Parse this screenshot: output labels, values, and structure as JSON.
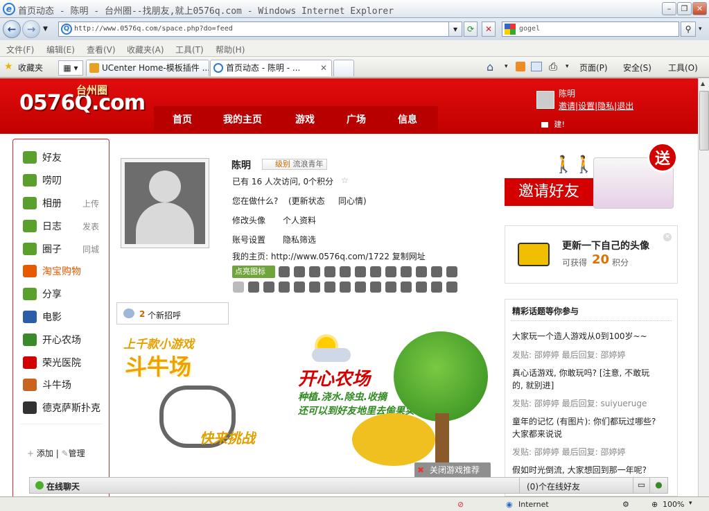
{
  "window": {
    "title": "首页动态 - 陈明 - 台州圈--找朋友,就上0576q.com - Windows Internet Explorer"
  },
  "address": {
    "url": "http://www.0576q.com/space.php?do=feed",
    "search_value": "gogel"
  },
  "menu": [
    "文件(F)",
    "编辑(E)",
    "查看(V)",
    "收藏夹(A)",
    "工具(T)",
    "帮助(H)"
  ],
  "favorites_label": "收藏夹",
  "tabs": [
    {
      "label": "UCenter Home-模板插件 ..."
    },
    {
      "label": "首页动态 - 陈明 - ..."
    }
  ],
  "toolbar": {
    "page": "页面(P)",
    "safety": "安全(S)",
    "tools": "工具(O)"
  },
  "site": {
    "logo": "0576Q.com",
    "logo_tag": "台州圈",
    "nav": [
      "首页",
      "我的主页",
      "游戏",
      "广场",
      "信息"
    ],
    "user": {
      "name": "陈明",
      "links": [
        "邀请",
        "设置",
        "隐私",
        "退出"
      ],
      "notice": "建!"
    }
  },
  "sidebar": {
    "items": [
      {
        "label": "好友",
        "extra": "",
        "icon": "friends-icon",
        "color": "#5aa02c"
      },
      {
        "label": "唠叨",
        "extra": "",
        "icon": "chat-icon",
        "color": "#5aa02c"
      },
      {
        "label": "相册",
        "extra": "上传",
        "icon": "camera-icon",
        "color": "#5aa02c"
      },
      {
        "label": "日志",
        "extra": "发表",
        "icon": "log-icon",
        "color": "#5aa02c"
      },
      {
        "label": "圈子",
        "extra": "同城",
        "icon": "group-icon",
        "color": "#5aa02c"
      },
      {
        "label": "淘宝购物",
        "extra": "",
        "icon": "taobao-icon",
        "color": "#e75a00"
      },
      {
        "label": "分享",
        "extra": "",
        "icon": "share-icon",
        "color": "#5aa02c"
      },
      {
        "label": "电影",
        "extra": "",
        "icon": "movie-icon",
        "color": "#2a5ea8"
      },
      {
        "label": "开心农场",
        "extra": "",
        "icon": "farm-icon",
        "color": "#3a8a2a"
      },
      {
        "label": "荣光医院",
        "extra": "",
        "icon": "hospital-icon",
        "color": "#d40000"
      },
      {
        "label": "斗牛场",
        "extra": "",
        "icon": "bull-icon",
        "color": "#c8641e"
      },
      {
        "label": "德克萨斯扑克",
        "extra": "",
        "icon": "poker-icon",
        "color": "#333333"
      }
    ],
    "add": "添加",
    "manage": "管理"
  },
  "profile": {
    "name": "陈明",
    "level_label": "级别",
    "level_value": "流浪青年",
    "visits": "已有 16 人次访问, 0个积分",
    "doing": "您在做什么?",
    "update_status": "(更新状态",
    "same_mood": "同心情)",
    "edit_avatar": "修改头像",
    "profile": "个人资料",
    "account": "账号设置",
    "privacy": "隐私筛选",
    "homepage": "我的主页: http://www.0576q.com/1722 复制网址",
    "light_icons": "点亮图标"
  },
  "greeting": {
    "count": "2",
    "label": "个新招呼"
  },
  "banner": {
    "game_title": "斗牛场",
    "game_sub": "上千款小游戏",
    "game_cta": "快来挑战",
    "farm_title": "开心农场",
    "farm_line1": "种植.浇水.除虫.收摘",
    "farm_line2": "还可以到好友地里去偷果实...",
    "close": "关闭游戏推荐"
  },
  "invite": {
    "label": "邀请好友",
    "badge": "送"
  },
  "update_avatar": {
    "title": "更新一下自己的头像",
    "prefix": "可获得",
    "points": "20",
    "suffix": "积分"
  },
  "topics": {
    "header": "精彩话题等你参与",
    "items": [
      {
        "title": "大家玩一个造人游戏从0到100岁~~",
        "meta": ""
      },
      {
        "title": "",
        "meta": "发贴: 邵婷婷  最后回复: 邵婷婷"
      },
      {
        "title": "真心话游戏, 你敢玩吗? [注意, 不敢玩",
        "meta": ""
      },
      {
        "title": "的, 就别进]",
        "meta": ""
      },
      {
        "title": "",
        "meta": "发贴: 邵婷婷  最后回复: suiyueruge"
      },
      {
        "title": "童年的记忆 (有图片): 你们都玩过哪些?",
        "meta": ""
      },
      {
        "title": "大家都来说说",
        "meta": ""
      },
      {
        "title": "",
        "meta": "发贴: 邵婷婷  最后回复: 邵婷婷"
      },
      {
        "title": "假如时光倒流, 大家想回到那一年呢?",
        "meta": ""
      }
    ]
  },
  "chat": {
    "label": "在线聊天",
    "online": "(0)个在线好友"
  },
  "status": {
    "zone": "Internet",
    "zoom": "100%"
  }
}
